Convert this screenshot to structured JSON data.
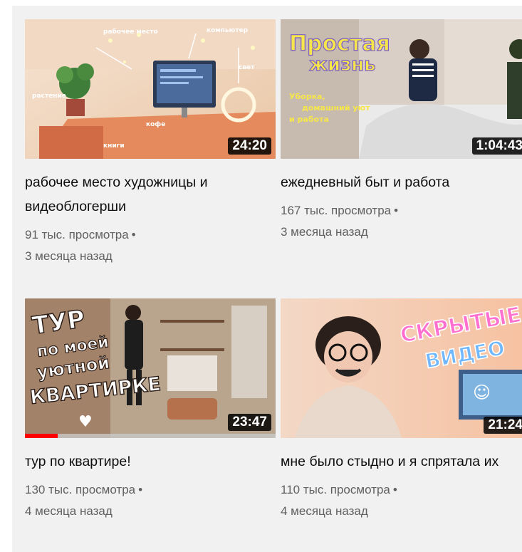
{
  "videos": [
    {
      "title": "рабочее место художницы и видеоблогерши",
      "views": "91 тыс. просмотра",
      "separator": "•",
      "age": "3 месяца назад",
      "duration": "24:20",
      "thumb_notes": [
        "рабочее место",
        "компьютер",
        "свет",
        "кофе",
        "книги",
        "растение"
      ]
    },
    {
      "title": "ежедневный быт и работа",
      "views": "167 тыс. просмотра",
      "separator": "•",
      "age": "3 месяца назад",
      "duration": "1:04:43",
      "thumb_title_1": "Простая",
      "thumb_title_2": "жизнь",
      "thumb_sub_1": "Уборка,",
      "thumb_sub_2": "домашний уют",
      "thumb_sub_3": "и работа"
    },
    {
      "title": "тур по квартире!",
      "views": "130 тыс. просмотра",
      "separator": "•",
      "age": "4 месяца назад",
      "duration": "23:47",
      "watch_progress": 0.13,
      "thumb_title_1": "ТУР",
      "thumb_title_2": "по моей",
      "thumb_title_3": "уютной",
      "thumb_title_4": "КВАРТИРКЕ",
      "thumb_heart": "♥"
    },
    {
      "title": "мне было стыдно и я спрятала их",
      "views": "110 тыс. просмотра",
      "separator": "•",
      "age": "4 месяца назад",
      "duration": "21:24",
      "thumb_title_1": "СКРЫТЫЕ",
      "thumb_title_2": "ВИДЕО",
      "thumb_smile": "☺"
    }
  ],
  "colors": {
    "progress": "#ff0000",
    "title_text": "#0f0f0f",
    "meta_text": "#606060",
    "panel_bg": "#f1f1f1"
  }
}
